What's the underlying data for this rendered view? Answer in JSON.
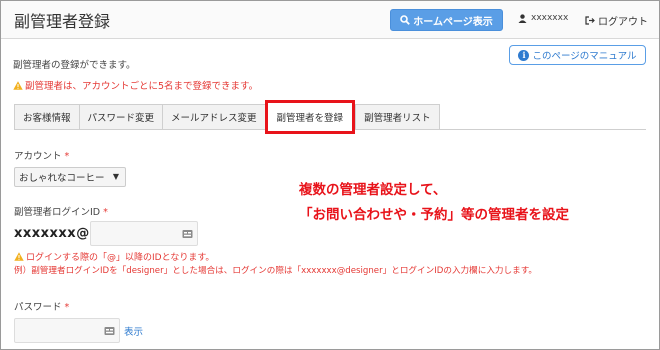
{
  "header": {
    "title": "副管理者登録",
    "home_button": "ホームページ表示",
    "username": "xxxxxxx",
    "logout": "ログアウト"
  },
  "info": {
    "description": "副管理者の登録ができます。",
    "warning": "副管理者は、アカウントごとに5名まで登録できます。",
    "manual_button": "このページのマニュアル"
  },
  "tabs": [
    {
      "label": "お客様情報"
    },
    {
      "label": "パスワード変更"
    },
    {
      "label": "メールアドレス変更"
    },
    {
      "label": "副管理者を登録",
      "active": true
    },
    {
      "label": "副管理者リスト"
    }
  ],
  "form": {
    "account_label": "アカウント",
    "required_mark": "*",
    "account_value": "おしゃれなコーヒー",
    "login_id_label": "副管理者ログインID",
    "login_prefix": "xxxxxxx@",
    "login_id_value": "",
    "login_help_1": "ログインする際の「@」以降のIDとなります。",
    "login_help_2": "例）副管理者ログインIDを「designer」とした場合は、ログインの際は「xxxxxxx@designer」とログインIDの入力欄に入力します。",
    "password_label": "パスワード",
    "password_value": "",
    "show_link": "表示"
  },
  "annotation": {
    "line1": "複数の管理者設定して、",
    "line2": "「お問い合わせや・予約」等の管理者を設定"
  },
  "colors": {
    "accent": "#5a9ee6",
    "warning": "#e53935",
    "highlight": "#e8131a"
  }
}
